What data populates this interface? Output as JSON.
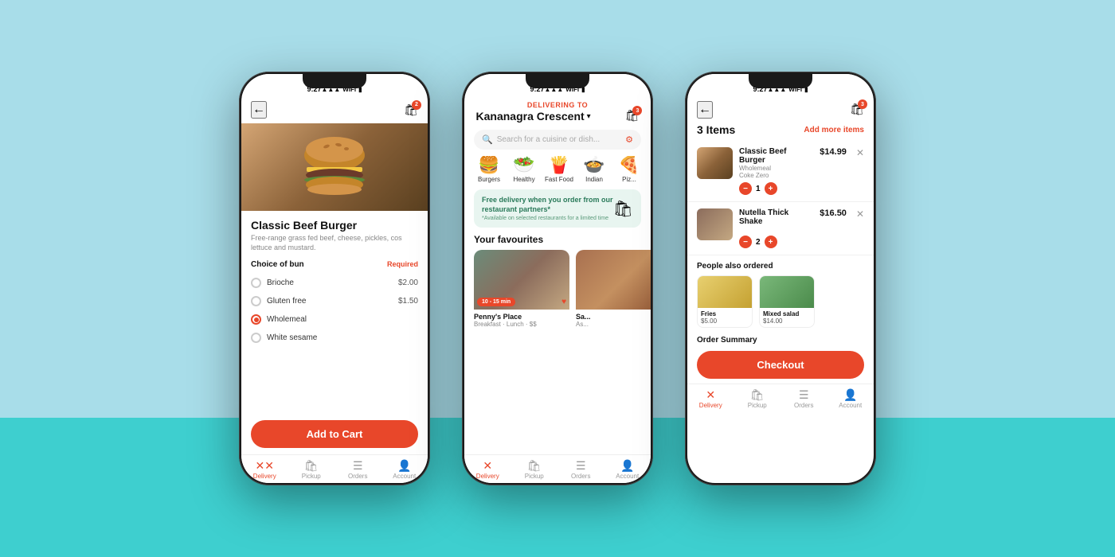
{
  "phone1": {
    "status_time": "9:27",
    "cart_badge": "2",
    "item": {
      "name": "Classic Beef Burger",
      "description": "Free-range grass fed beef, cheese, pickles, cos lettuce and mustard.",
      "choice_label": "Choice of bun",
      "required": "Required",
      "options": [
        {
          "label": "Brioche",
          "price": "$2.00",
          "selected": false
        },
        {
          "label": "Gluten free",
          "price": "$1.50",
          "selected": false
        },
        {
          "label": "Wholemeal",
          "price": "",
          "selected": true
        },
        {
          "label": "White sesame",
          "price": "",
          "selected": false
        }
      ]
    },
    "add_to_cart": "Add to Cart",
    "nav": [
      {
        "label": "Delivery",
        "active": true
      },
      {
        "label": "Pickup",
        "active": false
      },
      {
        "label": "Orders",
        "active": false
      },
      {
        "label": "Account",
        "active": false
      }
    ]
  },
  "phone2": {
    "status_time": "9:27",
    "cart_badge": "3",
    "delivering_to": "DELIVERING TO",
    "location": "Kananagra Crescent",
    "search_placeholder": "Search for a cuisine or dish...",
    "categories": [
      {
        "emoji": "🍔",
        "name": "Burgers"
      },
      {
        "emoji": "🥗",
        "name": "Healthy"
      },
      {
        "emoji": "🍟",
        "name": "Fast Food"
      },
      {
        "emoji": "🍲",
        "name": "Indian"
      },
      {
        "emoji": "🍕",
        "name": "Piz..."
      }
    ],
    "promo": {
      "title": "Free delivery when you order from our restaurant partners*",
      "subtitle": "*Available on selected restaurants for a limited time"
    },
    "favourites_title": "Your favourites",
    "restaurants": [
      {
        "name": "Penny's Place",
        "sub": "Breakfast · Lunch · $$",
        "time": "10 - 15 min"
      },
      {
        "name": "Sa...",
        "sub": "As..."
      }
    ],
    "nav": [
      {
        "label": "Delivery",
        "active": true
      },
      {
        "label": "Pickup",
        "active": false
      },
      {
        "label": "Orders",
        "active": false
      },
      {
        "label": "Account",
        "active": false
      }
    ]
  },
  "phone3": {
    "status_time": "9:27",
    "cart_badge": "3",
    "items_count": "3 Items",
    "add_more": "Add more items",
    "items": [
      {
        "name": "Classic Beef Burger",
        "sub1": "Wholemeal",
        "sub2": "Coke Zero",
        "qty": "1",
        "price": "$14.99"
      },
      {
        "name": "Nutella Thick Shake",
        "sub1": "",
        "sub2": "",
        "qty": "2",
        "price": "$16.50"
      }
    ],
    "also_ordered_title": "People also ordered",
    "also_items": [
      {
        "name": "Fries",
        "price": "$5.00"
      },
      {
        "name": "Mixed salad",
        "price": "$14.00"
      }
    ],
    "order_summary": "Order Summary",
    "checkout": "Checkout",
    "nav": [
      {
        "label": "Delivery",
        "active": true
      },
      {
        "label": "Pickup",
        "active": false
      },
      {
        "label": "Orders",
        "active": false
      },
      {
        "label": "Account",
        "active": false
      }
    ]
  }
}
